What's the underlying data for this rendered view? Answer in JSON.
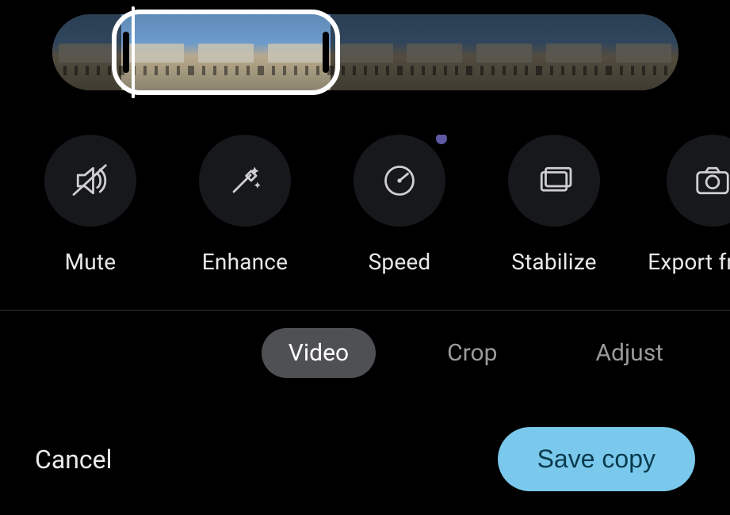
{
  "timeline": {
    "total_frames": 9,
    "selection_start_frame": 1,
    "selection_end_frame": 3,
    "playhead_frame": 1.15
  },
  "tools": [
    {
      "id": "mute",
      "label": "Mute",
      "icon": "mute-icon",
      "badge": false
    },
    {
      "id": "enhance",
      "label": "Enhance",
      "icon": "wand-icon",
      "badge": false
    },
    {
      "id": "speed",
      "label": "Speed",
      "icon": "speed-icon",
      "badge": true
    },
    {
      "id": "stabilize",
      "label": "Stabilize",
      "icon": "stabilize-icon",
      "badge": false
    },
    {
      "id": "export",
      "label": "Export frame",
      "icon": "camera-icon",
      "badge": false
    }
  ],
  "tabs": [
    {
      "id": "video",
      "label": "Video",
      "active": true
    },
    {
      "id": "crop",
      "label": "Crop",
      "active": false
    },
    {
      "id": "adjust",
      "label": "Adjust",
      "active": false
    }
  ],
  "actions": {
    "cancel_label": "Cancel",
    "save_label": "Save copy"
  },
  "colors": {
    "accent_save": "#7ac9ec",
    "tool_bg": "#16181c",
    "tab_active_bg": "#4f5053",
    "badge": "#5f58a3"
  }
}
